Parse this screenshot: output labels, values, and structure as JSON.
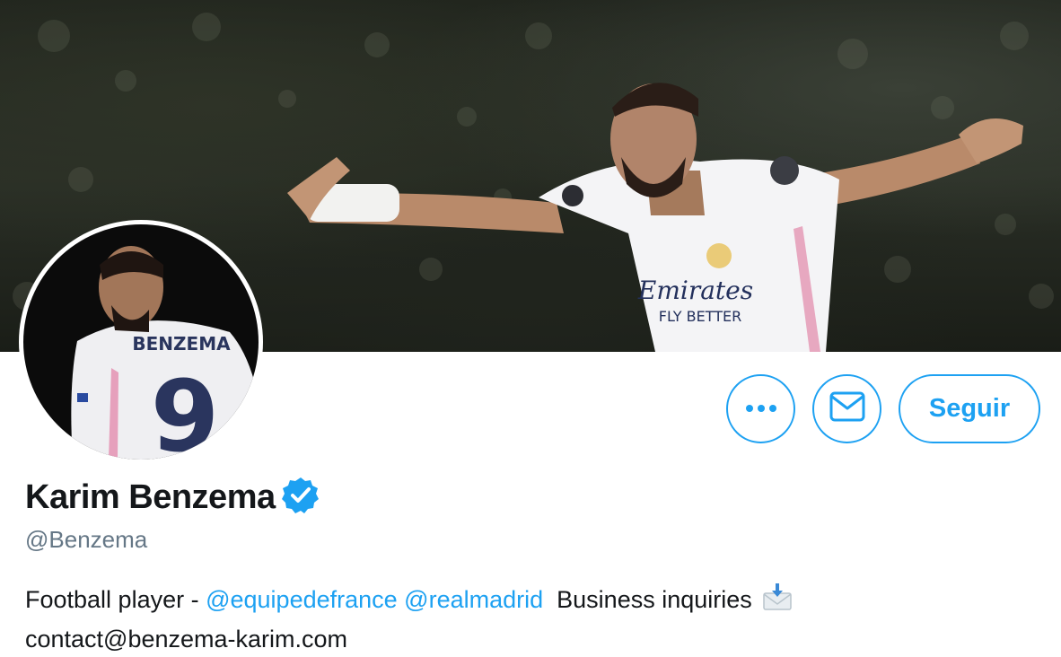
{
  "profile": {
    "name": "Karim Benzema",
    "handle": "@Benzema",
    "verified": true,
    "bio": {
      "prefix": "Football player - ",
      "mention_1": "@equipedefrance",
      "mention_2": "@realmadrid",
      "middle": "Business inquiries",
      "email": "contact@benzema-karim.com"
    }
  },
  "banner": {
    "jersey_sponsor_line1": "Emirates",
    "jersey_sponsor_line2": "FLY BETTER"
  },
  "avatar": {
    "jersey_name": "BENZEMA",
    "jersey_number": "9"
  },
  "actions": {
    "more_icon": "more-horizontal-icon",
    "message_icon": "envelope-icon",
    "follow_label": "Seguir"
  },
  "colors": {
    "accent": "#1da1f2",
    "text_primary": "#14171a",
    "text_secondary": "#657786"
  }
}
